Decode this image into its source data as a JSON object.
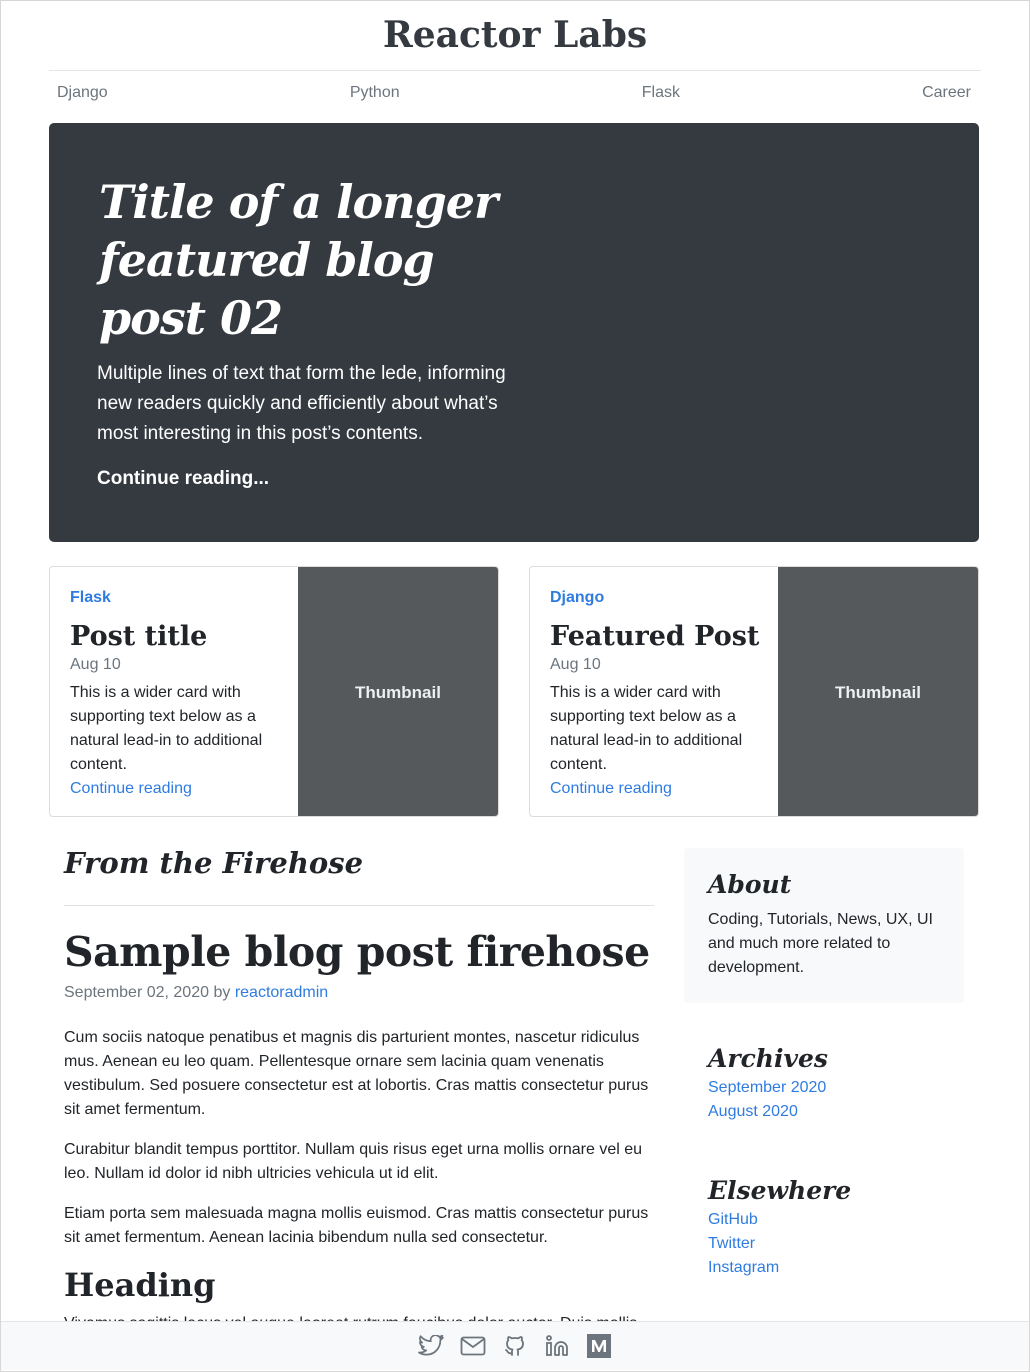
{
  "header": {
    "brand": "Reactor Labs"
  },
  "nav": [
    "Django",
    "Python",
    "Flask",
    "Career"
  ],
  "hero": {
    "title": "Title of a longer featured blog post 02",
    "lede": "Multiple lines of text that form the lede, informing new readers quickly and efficiently about what’s most interesting in this post’s contents.",
    "link": "Continue reading..."
  },
  "cards": [
    {
      "category": "Flask",
      "title": "Post title",
      "date": "Aug 10",
      "text": "This is a wider card with supporting text below as a natural lead-in to additional content.",
      "link": "Continue reading",
      "thumb": "Thumbnail"
    },
    {
      "category": "Django",
      "title": "Featured Post",
      "date": "Aug 10",
      "text": "This is a wider card with supporting text below as a natural lead-in to additional content.",
      "link": "Continue reading",
      "thumb": "Thumbnail"
    }
  ],
  "main": {
    "heading": "From the Firehose",
    "post": {
      "title": "Sample blog post firehose",
      "date": "September 02, 2020",
      "by": "by",
      "author": "reactoradmin",
      "paragraphs": [
        "Cum sociis natoque penatibus et magnis dis parturient montes, nascetur ridiculus mus. Aenean eu leo quam. Pellentesque ornare sem lacinia quam venenatis vestibulum. Sed posuere consectetur est at lobortis. Cras mattis consectetur purus sit amet fermentum.",
        "Curabitur blandit tempus porttitor. Nullam quis risus eget urna mollis ornare vel eu leo. Nullam id dolor id nibh ultricies vehicula ut id elit.",
        "Etiam porta sem malesuada magna mollis euismod. Cras mattis consectetur purus sit amet fermentum. Aenean lacinia bibendum nulla sed consectetur."
      ],
      "subheading": "Heading",
      "cut_text": "Vivamus sagittis lacus vel augue laoreet rutrum faucibus dolor auctor. Duis mollis"
    }
  },
  "sidebar": {
    "about": {
      "title": "About",
      "text": "Coding, Tutorials, News, UX, UI and much more related to development."
    },
    "archives": {
      "title": "Archives",
      "items": [
        "September 2020",
        "August 2020"
      ]
    },
    "elsewhere": {
      "title": "Elsewhere",
      "items": [
        "GitHub",
        "Twitter",
        "Instagram"
      ]
    }
  },
  "footer": {
    "icons": [
      "twitter-icon",
      "mail-icon",
      "github-icon",
      "linkedin-icon",
      "medium-icon"
    ]
  },
  "colors": {
    "hero_bg": "#343a40",
    "link": "#2f7ce0",
    "thumb_bg": "#55595c",
    "muted": "#6c757d"
  }
}
